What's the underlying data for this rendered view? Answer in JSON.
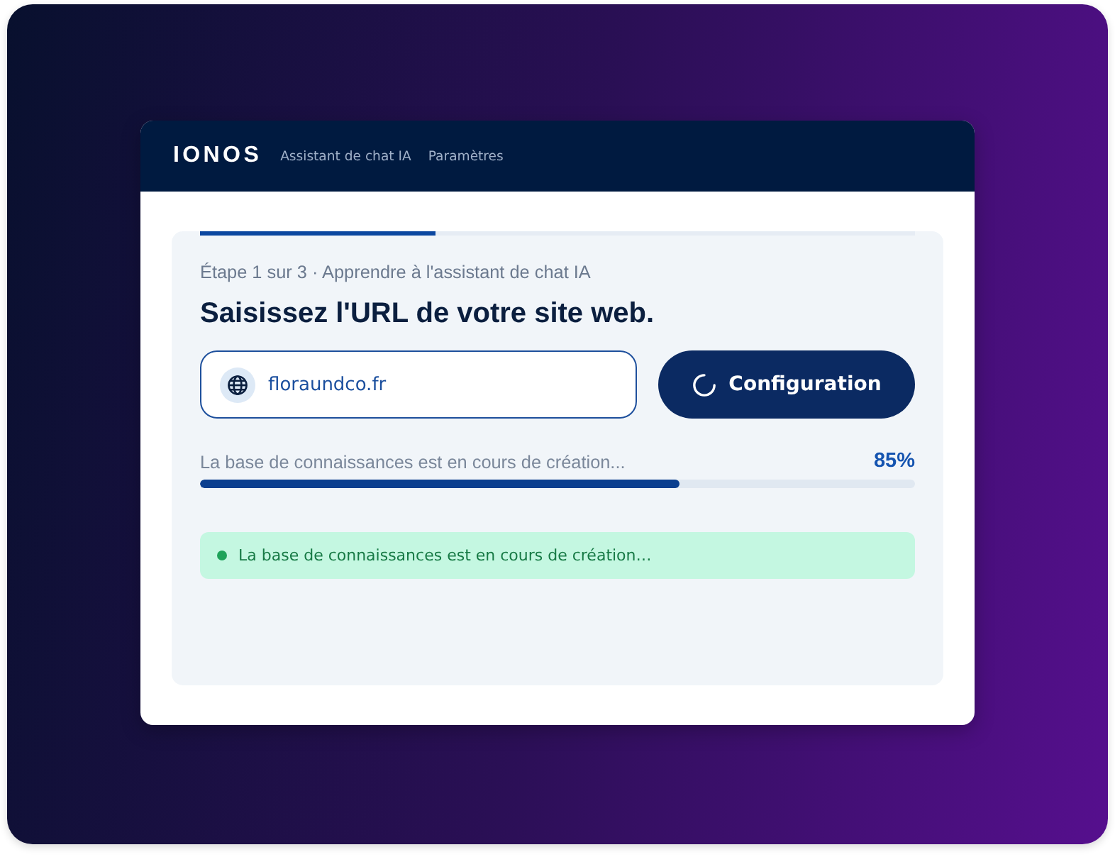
{
  "header": {
    "logo": "IONOS",
    "nav": [
      {
        "label": "Assistant de chat IA"
      },
      {
        "label": "Paramètres"
      }
    ]
  },
  "step_progress": {
    "level": 0.33
  },
  "step_label": "Étape 1 sur 3 · Apprendre à l'assistant de chat IA",
  "title": "Saisissez l'URL de votre site web.",
  "url_field": {
    "value": "floraundco.fr"
  },
  "button": {
    "label": "Configuration",
    "loading": true
  },
  "progress": {
    "label": "La base de connaissances est en cours de création...",
    "percent": "85%",
    "level": 0.67
  },
  "status": {
    "text": "La base de connaissances est en cours de création…"
  }
}
